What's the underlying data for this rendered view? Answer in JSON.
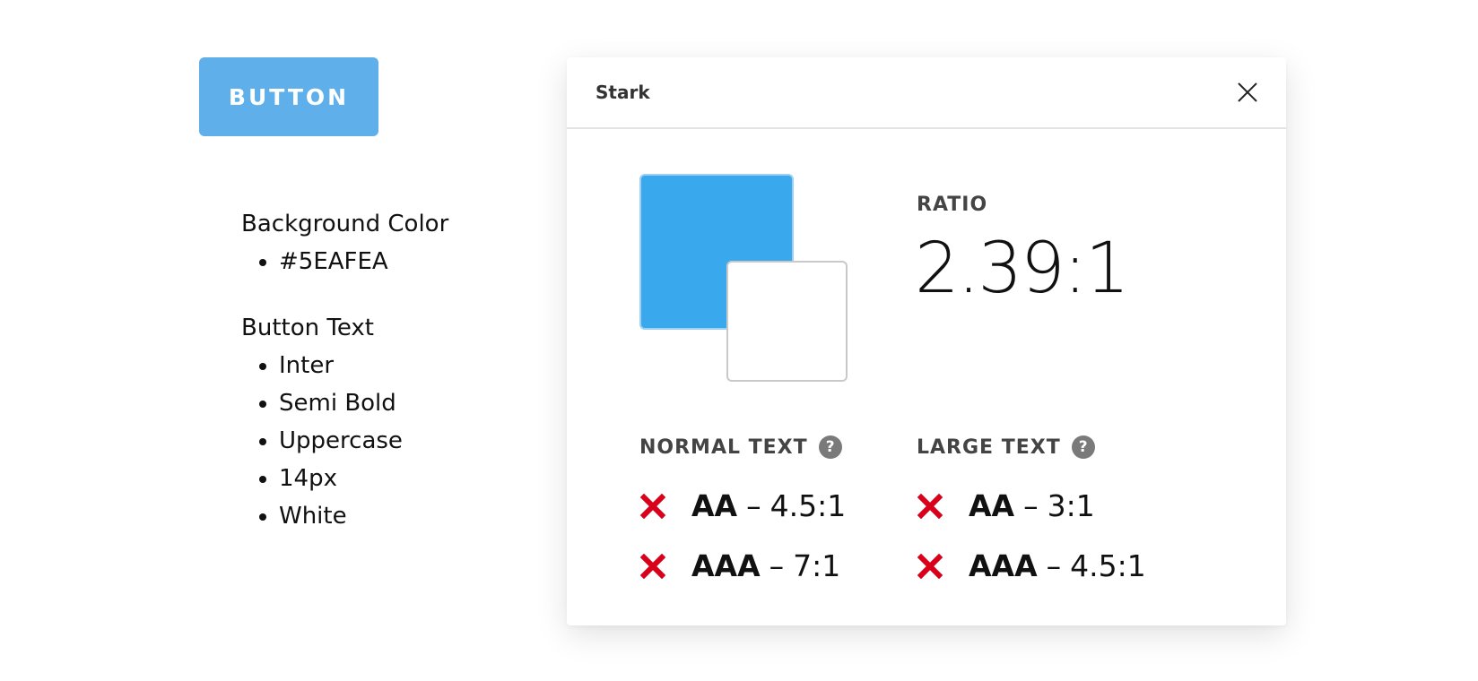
{
  "sample_button": {
    "label": "BUTTON",
    "background": "#5EAFEA",
    "text_color": "#FFFFFF"
  },
  "spec": {
    "background_heading": "Background Color",
    "background_items": [
      "#5EAFEA"
    ],
    "text_heading": "Button Text",
    "text_items": [
      "Inter",
      "Semi Bold",
      "Uppercase",
      "14px",
      "White"
    ]
  },
  "stark": {
    "title": "Stark",
    "foreground_color": "#3AA8EC",
    "background_color": "#FFFFFF",
    "ratio_label": "RATIO",
    "ratio_value": "2.39:1",
    "normal_text": {
      "label": "NORMAL TEXT",
      "checks": [
        {
          "level": "AA",
          "requirement": "4.5:1",
          "status": "fail"
        },
        {
          "level": "AAA",
          "requirement": "7:1",
          "status": "fail"
        }
      ]
    },
    "large_text": {
      "label": "LARGE TEXT",
      "checks": [
        {
          "level": "AA",
          "requirement": "3:1",
          "status": "fail"
        },
        {
          "level": "AAA",
          "requirement": "4.5:1",
          "status": "fail"
        }
      ]
    },
    "dash": "–",
    "help_glyph": "?",
    "fail_color": "#D9001B"
  }
}
